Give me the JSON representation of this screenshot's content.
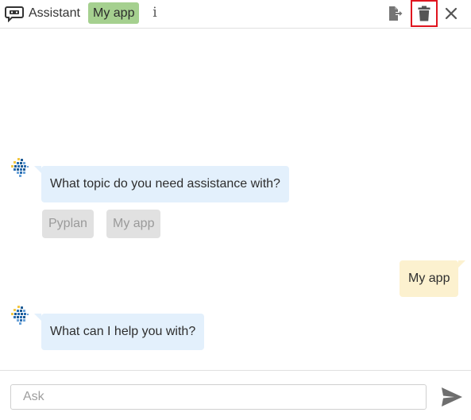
{
  "header": {
    "title": "Assistant",
    "app_badge": "My app",
    "info_glyph": "i",
    "icons": {
      "bot": "robot-chat-icon",
      "export": "export-icon",
      "delete": "trash-icon",
      "close": "close-icon"
    },
    "badge_color": "#a5d08f",
    "delete_highlight_color": "#e0141e"
  },
  "chat": {
    "messages": [
      {
        "from": "bot",
        "text": "What topic do you need assistance with?"
      },
      {
        "from": "user",
        "text": "My app"
      },
      {
        "from": "bot",
        "text": "What can I help you with?"
      }
    ],
    "options": [
      "Pyplan",
      "My app"
    ],
    "bot_bubble_color": "#e3f0fc",
    "user_bubble_color": "#fcf1cf"
  },
  "footer": {
    "input_placeholder": "Ask",
    "input_value": "",
    "send_icon": "send-icon"
  }
}
